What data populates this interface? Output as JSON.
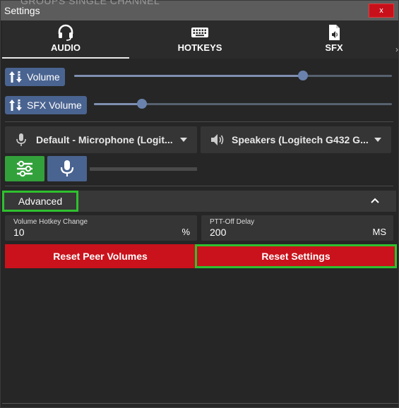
{
  "window": {
    "title": "Settings",
    "close_label": "x",
    "behind_text": "GROUPS    SINGLE CHANNEL"
  },
  "tabs": [
    {
      "label": "AUDIO",
      "icon": "headset-icon",
      "active": true
    },
    {
      "label": "HOTKEYS",
      "icon": "keyboard-icon",
      "active": false
    },
    {
      "label": "SFX",
      "icon": "audio-file-icon",
      "active": false
    }
  ],
  "volume": {
    "label": "Volume",
    "level": 0.72
  },
  "sfx_volume": {
    "label": "SFX Volume",
    "level": 0.16
  },
  "devices": {
    "input": "Default - Microphone (Logit...",
    "output": "Speakers (Logitech G432 G..."
  },
  "mic_level": 0,
  "advanced": {
    "label": "Advanced",
    "volume_hotkey_change": {
      "label": "Volume Hotkey Change",
      "value": "10",
      "unit": "%"
    },
    "ptt_off_delay": {
      "label": "PTT-Off Delay",
      "value": "200",
      "unit": "MS"
    }
  },
  "buttons": {
    "reset_peer_volumes": "Reset Peer Volumes",
    "reset_settings": "Reset Settings"
  },
  "colors": {
    "accent_blue": "#4a6491",
    "green": "#33a13b",
    "danger": "#c9121b",
    "highlight": "#2fc12f"
  }
}
